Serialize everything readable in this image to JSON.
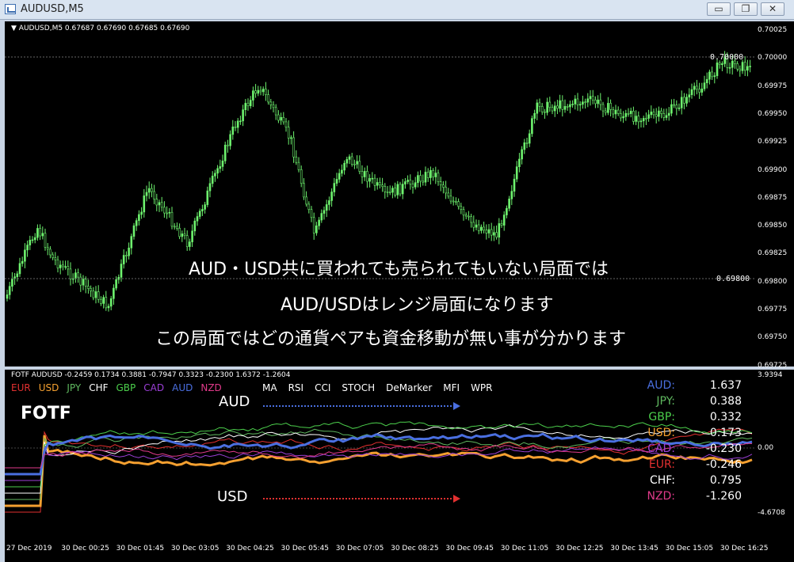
{
  "window": {
    "title": "AUDUSD,M5",
    "buttons": {
      "minimize": "▭",
      "restore": "❐",
      "close": "✕"
    }
  },
  "main_chart": {
    "header": "AUDUSD,M5  0.67687 0.67690 0.67685 0.67690",
    "price_ticks": [
      "0.70025",
      "0.70000",
      "0.69975",
      "0.69950",
      "0.69925",
      "0.69900",
      "0.69875",
      "0.69850",
      "0.69825",
      "0.69800",
      "0.69775",
      "0.69750",
      "0.69725"
    ],
    "level_high": "0.70000",
    "level_low": "0.69800",
    "overlay_line1": "AUD・USD共に買われても売られてもいない局面では",
    "overlay_line2": "AUD/USDはレンジ局面になります",
    "overlay_line3": "この局面ではどの通貨ペアも資金移動が無い事が分かります",
    "colors": {
      "candle": "#6ef36e",
      "background": "#000000"
    }
  },
  "sub_chart": {
    "header": "FOTF AUDUSD -0.2459 0.1734 0.3881 -0.7947 0.3323 -0.2300 1.6372 -1.2604",
    "legend": [
      {
        "label": "EUR",
        "color": "#e23030"
      },
      {
        "label": "USD",
        "color": "#f5a030"
      },
      {
        "label": "JPY",
        "color": "#5fb85f"
      },
      {
        "label": "CHF",
        "color": "#ffffff"
      },
      {
        "label": "GBP",
        "color": "#4cd04c"
      },
      {
        "label": "CAD",
        "color": "#9b3fd6"
      },
      {
        "label": "AUD",
        "color": "#4a6fe0"
      },
      {
        "label": "NZD",
        "color": "#e03a8a"
      }
    ],
    "menu": [
      "MA",
      "RSI",
      "CCI",
      "STOCH",
      "DeMarker",
      "MFI",
      "WPR"
    ],
    "fotf_label": "FOTF",
    "aud_label": "AUD",
    "usd_label": "USD",
    "ticks": [
      "3.9394",
      "0.00",
      "-4.6708"
    ],
    "table": [
      {
        "name": "AUD:",
        "value": "1.637",
        "color": "#4a6fe0"
      },
      {
        "name": "JPY:",
        "value": "0.388",
        "color": "#5fb85f"
      },
      {
        "name": "GBP:",
        "value": "0.332",
        "color": "#4cd04c"
      },
      {
        "name": "USD:",
        "value": "0.173",
        "color": "#f5a030"
      },
      {
        "name": "CAD:",
        "value": "-0.230",
        "color": "#9b3fd6"
      },
      {
        "name": "EUR:",
        "value": "-0.246",
        "color": "#e23030"
      },
      {
        "name": "CHF:",
        "value": "0.795",
        "color": "#ffffff"
      },
      {
        "name": "NZD:",
        "value": "-1.260",
        "color": "#e03a8a"
      }
    ]
  },
  "time_axis": [
    "27 Dec 2019",
    "30 Dec 00:25",
    "30 Dec 01:45",
    "30 Dec 03:05",
    "30 Dec 04:25",
    "30 Dec 05:45",
    "30 Dec 07:05",
    "30 Dec 08:25",
    "30 Dec 09:45",
    "30 Dec 11:05",
    "30 Dec 12:25",
    "30 Dec 13:45",
    "30 Dec 15:05",
    "30 Dec 16:25"
  ]
}
